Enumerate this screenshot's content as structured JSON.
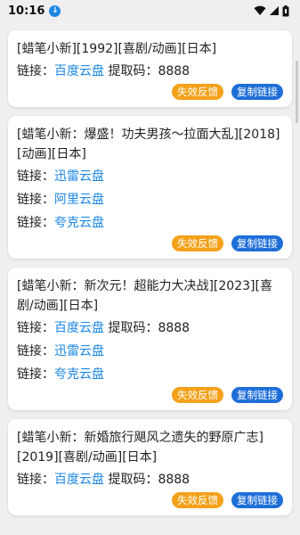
{
  "status": {
    "time": "10:16"
  },
  "common": {
    "link_prefix": "链接：",
    "code_prefix": "提取码：",
    "feedback_label": "失效反馈",
    "copy_label": "复制链接"
  },
  "cards": [
    {
      "title": "[蜡笔小新][1992][喜剧/动画][日本]",
      "links": [
        {
          "service": "百度云盘",
          "code": "8888"
        }
      ]
    },
    {
      "title": "[蜡笔小新：爆盛！功夫男孩～拉面大乱][2018][动画][日本]",
      "links": [
        {
          "service": "迅雷云盘"
        },
        {
          "service": "阿里云盘"
        },
        {
          "service": "夸克云盘"
        }
      ]
    },
    {
      "title": "[蜡笔小新：新次元！超能力大决战][2023][喜剧/动画][日本]",
      "links": [
        {
          "service": "百度云盘",
          "code": "8888"
        },
        {
          "service": "迅雷云盘"
        },
        {
          "service": "夸克云盘"
        }
      ]
    },
    {
      "title": "[蜡笔小新：新婚旅行飓风之遗失的野原广志][2019][喜剧/动画][日本]",
      "links": [
        {
          "service": "百度云盘",
          "code": "8888"
        }
      ]
    }
  ]
}
